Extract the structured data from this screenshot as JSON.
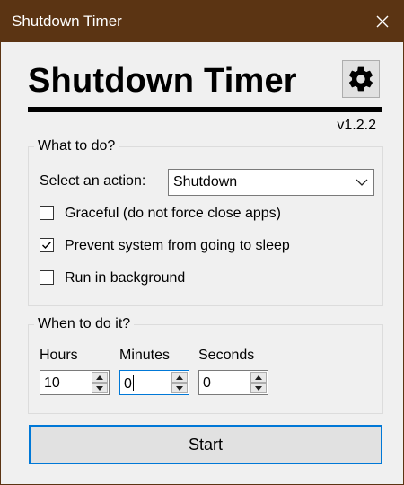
{
  "window": {
    "title": "Shutdown Timer"
  },
  "header": {
    "app_title": "Shutdown Timer",
    "version": "v1.2.2",
    "settings_icon": "gear-icon"
  },
  "what": {
    "legend": "What to do?",
    "action_label": "Select an action:",
    "action_value": "Shutdown",
    "options": [
      {
        "label": "Graceful (do not force close apps)",
        "checked": false
      },
      {
        "label": "Prevent system from going to sleep",
        "checked": true
      },
      {
        "label": "Run in background",
        "checked": false
      }
    ]
  },
  "when": {
    "legend": "When to do it?",
    "hours_label": "Hours",
    "hours_value": "10",
    "minutes_label": "Minutes",
    "minutes_value": "0",
    "seconds_label": "Seconds",
    "seconds_value": "0"
  },
  "start_label": "Start",
  "colors": {
    "titlebar": "#5b3413",
    "accent": "#0078d7"
  }
}
